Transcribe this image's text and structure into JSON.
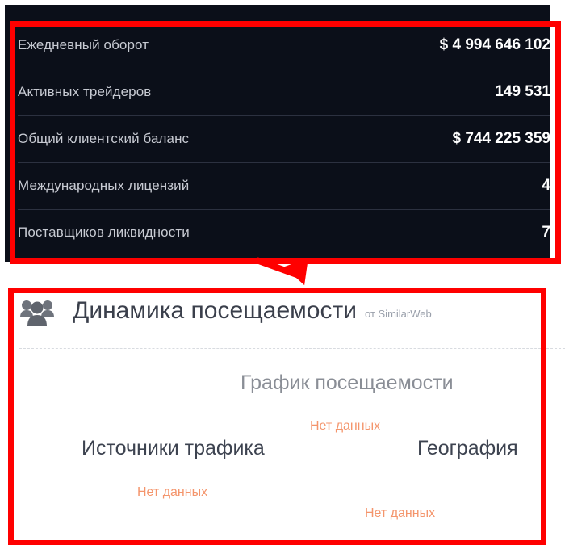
{
  "stats": [
    {
      "label": "Ежедневный оборот",
      "value": "$ 4 994 646 102"
    },
    {
      "label": "Активных трейдеров",
      "value": "149 531"
    },
    {
      "label": "Общий клиентский баланс",
      "value": "$ 744 225 359"
    },
    {
      "label": "Международных лицензий",
      "value": "4"
    },
    {
      "label": "Поставщиков ликвидности",
      "value": "7"
    }
  ],
  "traffic": {
    "icon": "users-icon",
    "title": "Динамика посещаемости",
    "source": "от SimilarWeb",
    "widgets": [
      {
        "title": "График посещаемости",
        "status": "Нет данных"
      },
      {
        "title": "Источники трафика",
        "status": "Нет данных"
      },
      {
        "title": "География",
        "status": "Нет данных"
      }
    ]
  },
  "colors": {
    "highlight": "#ff0000",
    "panel_bg": "#0b0f19",
    "no_data": "#f4956c"
  }
}
